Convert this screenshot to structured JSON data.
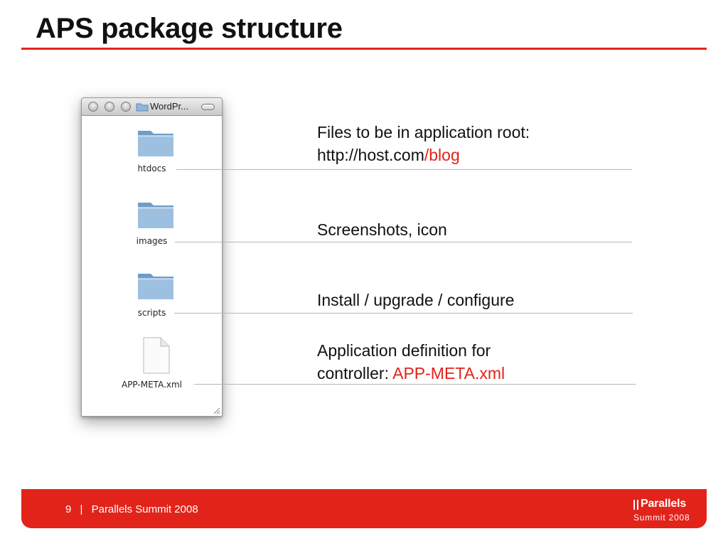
{
  "slide": {
    "title": "APS package structure"
  },
  "finder": {
    "window_title": "WordPr...",
    "items": [
      {
        "label": "htdocs",
        "icon": "folder-icon"
      },
      {
        "label": "images",
        "icon": "folder-icon"
      },
      {
        "label": "scripts",
        "icon": "folder-icon"
      },
      {
        "label": "APP-META.xml",
        "icon": "document-icon"
      }
    ]
  },
  "descriptions": [
    {
      "line1": "Files to be in application root:",
      "line2_prefix": "http://host.com",
      "line2_highlight": "/blog"
    },
    {
      "text": "Screenshots, icon"
    },
    {
      "text": "Install / upgrade / configure"
    },
    {
      "line1": "Application definition for",
      "line2_prefix": "controller: ",
      "line2_highlight": "APP-META.xml"
    }
  ],
  "footer": {
    "page_number": "9",
    "separator": "|",
    "event": "Parallels Summit 2008",
    "logo_name": "Parallels",
    "logo_sub": "Summit 2008"
  },
  "colors": {
    "accent": "#e2231a",
    "folder": "#7fa8cf"
  }
}
